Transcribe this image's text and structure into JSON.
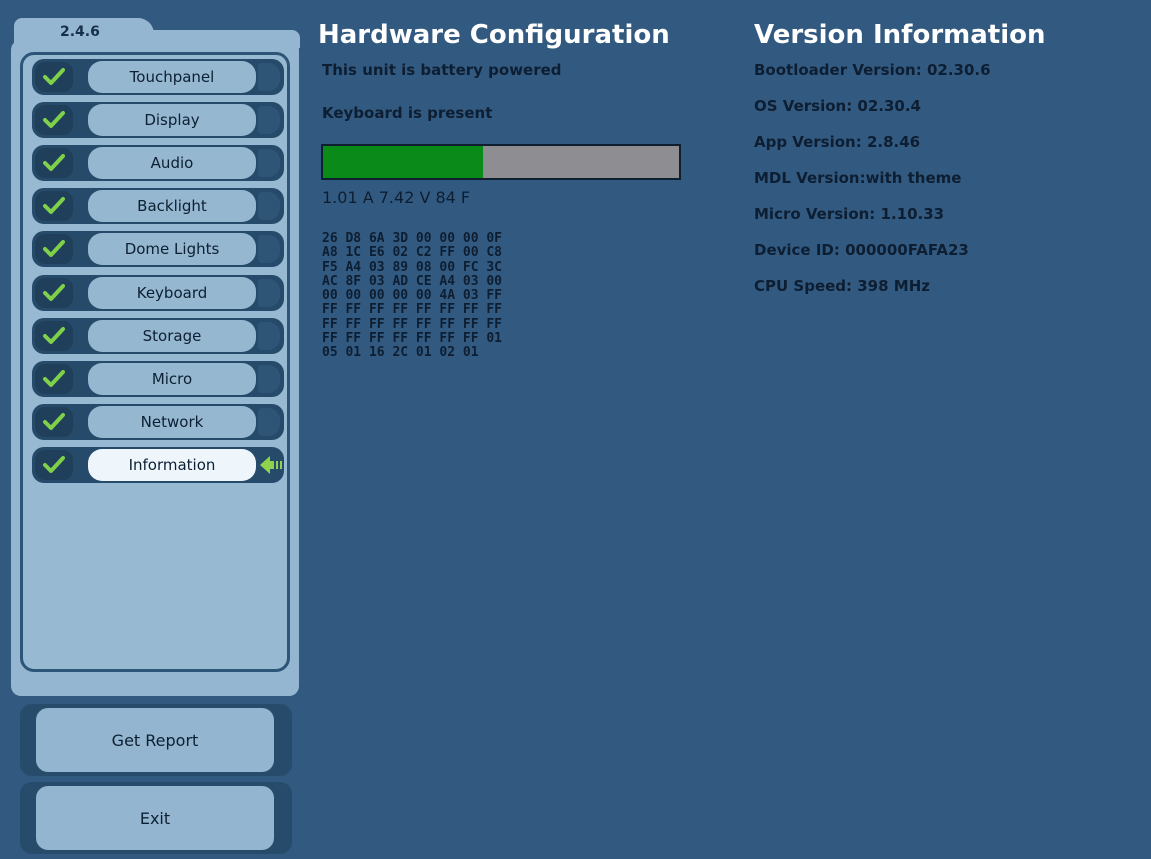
{
  "version_tab": "2.4.6",
  "nav": {
    "items": [
      {
        "label": "Touchpanel",
        "status": "check-icon"
      },
      {
        "label": "Display",
        "status": "check-icon"
      },
      {
        "label": "Audio",
        "status": "check-icon"
      },
      {
        "label": "Backlight",
        "status": "check-icon"
      },
      {
        "label": "Dome Lights",
        "status": "check-icon"
      },
      {
        "label": "Keyboard",
        "status": "check-icon"
      },
      {
        "label": "Storage",
        "status": "check-icon"
      },
      {
        "label": "Micro",
        "status": "check-icon"
      },
      {
        "label": "Network",
        "status": "check-icon"
      },
      {
        "label": "Information",
        "status": "check-icon",
        "selected": true
      }
    ]
  },
  "actions": {
    "get_report": "Get Report",
    "exit": "Exit"
  },
  "hardware": {
    "title": "Hardware Configuration",
    "battery": "This unit is battery powered",
    "keyboard": "Keyboard is present",
    "battery_level": 0.45,
    "readings": "1.01 A 7.42 V 84 F",
    "hex_rows": [
      "26 D8 6A 3D 00 00 00 0F",
      "A8 1C E6 02 C2 FF 00 C8",
      "F5 A4 03 89 08 00 FC 3C",
      "AC 8F 03 AD CE A4 03 00",
      "00 00 00 00 00 4A 03 FF",
      "FF FF FF FF FF FF FF FF",
      "FF FF FF FF FF FF FF FF",
      "FF FF FF FF FF FF FF 01",
      "05 01 16 2C 01 02 01"
    ]
  },
  "version_info": {
    "title": "Version Information",
    "lines": [
      "Bootloader Version: 02.30.6",
      "OS Version: 02.30.4",
      "App Version: 2.8.46",
      "MDL Version:with theme",
      "Micro Version: 1.10.33",
      "Device ID: 000000FAFA23",
      "CPU Speed: 398 MHz"
    ]
  },
  "colors": {
    "background": "#325a80",
    "panel": "#94b6d0",
    "check": "#7fd14a",
    "progress_fill": "#0a8a18",
    "progress_track": "#8e8e92",
    "title_text": "#ffffff"
  }
}
